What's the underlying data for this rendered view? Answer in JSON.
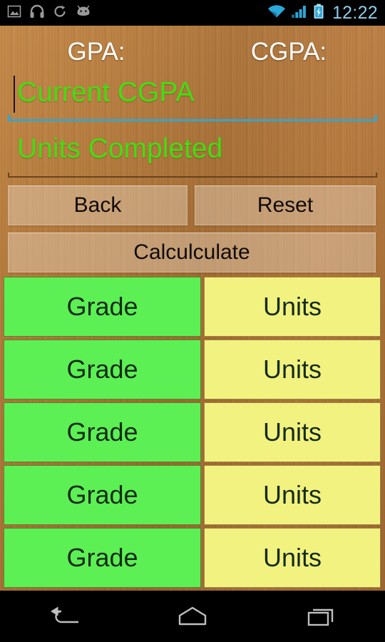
{
  "status_bar": {
    "left_icons": [
      {
        "name": "screenshot-image-icon"
      },
      {
        "name": "headphones-icon"
      },
      {
        "name": "sync-refresh-icon"
      },
      {
        "name": "android-robot-icon"
      }
    ],
    "right_icons": [
      {
        "name": "wifi-icon"
      },
      {
        "name": "cellular-signal-icon"
      },
      {
        "name": "battery-charging-icon"
      }
    ],
    "clock": "12:22",
    "clock_color": "#8ECCE8",
    "background_color": "#000000"
  },
  "header": {
    "gpa_label": "GPA:",
    "cgpa_label": "CGPA:",
    "text_color": "#FFFFFF"
  },
  "form": {
    "fields": [
      {
        "name": "current-cgpa",
        "placeholder": "Current CGPA",
        "value": "",
        "focused": true,
        "underline_color": "#33A5D1",
        "text_color": "#44DD11"
      },
      {
        "name": "units-completed",
        "placeholder": "Units Completed",
        "value": "",
        "focused": false,
        "underline_color": "#5D3A18",
        "text_color": "#44DD11"
      }
    ]
  },
  "buttons": {
    "back_label": "Back",
    "reset_label": "Reset",
    "calculate_label": "Calculculate"
  },
  "grid": {
    "grade_color": "#5CF055",
    "units_color": "#F2F281",
    "rows": [
      {
        "grade": "Grade",
        "units": "Units"
      },
      {
        "grade": "Grade",
        "units": "Units"
      },
      {
        "grade": "Grade",
        "units": "Units"
      },
      {
        "grade": "Grade",
        "units": "Units"
      },
      {
        "grade": "Grade",
        "units": "Units"
      }
    ]
  },
  "nav_bar": {
    "items": [
      {
        "name": "back-nav-icon"
      },
      {
        "name": "home-nav-icon"
      },
      {
        "name": "recents-nav-icon"
      }
    ],
    "background_color": "#000000"
  },
  "theme": {
    "wood_background": "#B5783A",
    "button_fill": "#BD9670"
  }
}
